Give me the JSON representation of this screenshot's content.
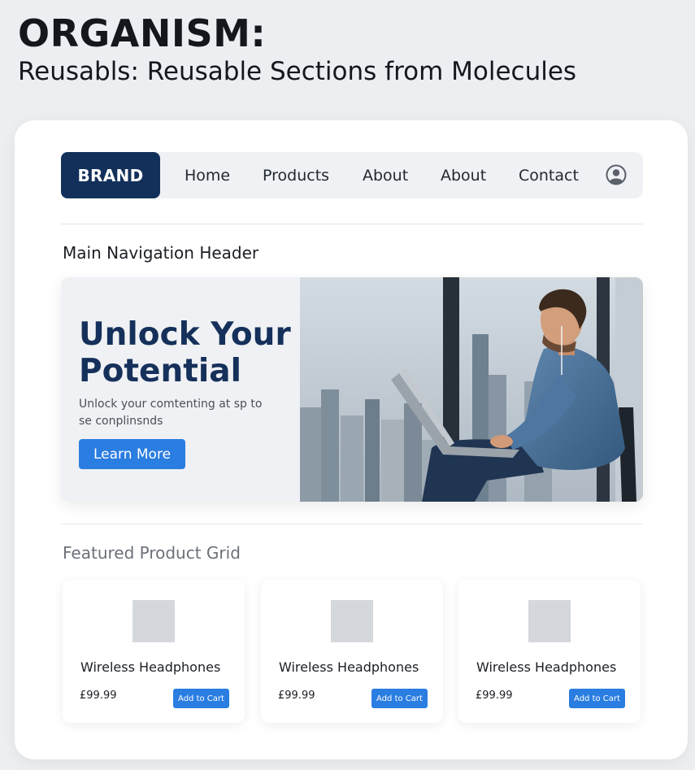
{
  "header": {
    "title": "ORGANISM:",
    "subtitle": "Reusabls: Reusable Sections from Molecules"
  },
  "nav": {
    "brand": "BRAND",
    "links": [
      "Home",
      "Products",
      "About",
      "About",
      "Contact"
    ],
    "account_icon": "user-circle-icon"
  },
  "sections": {
    "nav_label": "Main Navigation Header",
    "grid_label": "Featured Product Grid"
  },
  "hero": {
    "title": "Unlock Your Potential",
    "body": "Unlock your comtenting at sp to se conplinsnds",
    "button": "Learn More"
  },
  "products": [
    {
      "name": "Wireless Headphones",
      "price": "£99.99",
      "button": "Add to Cart"
    },
    {
      "name": "Wireless Headphones",
      "price": "£99.99",
      "button": "Add to Cart"
    },
    {
      "name": "Wireless Headphones",
      "price": "£99.99",
      "button": "Add to Cart"
    }
  ],
  "colors": {
    "brand": "#12305a",
    "accent": "#2a7de1",
    "hero_title": "#15305a"
  }
}
